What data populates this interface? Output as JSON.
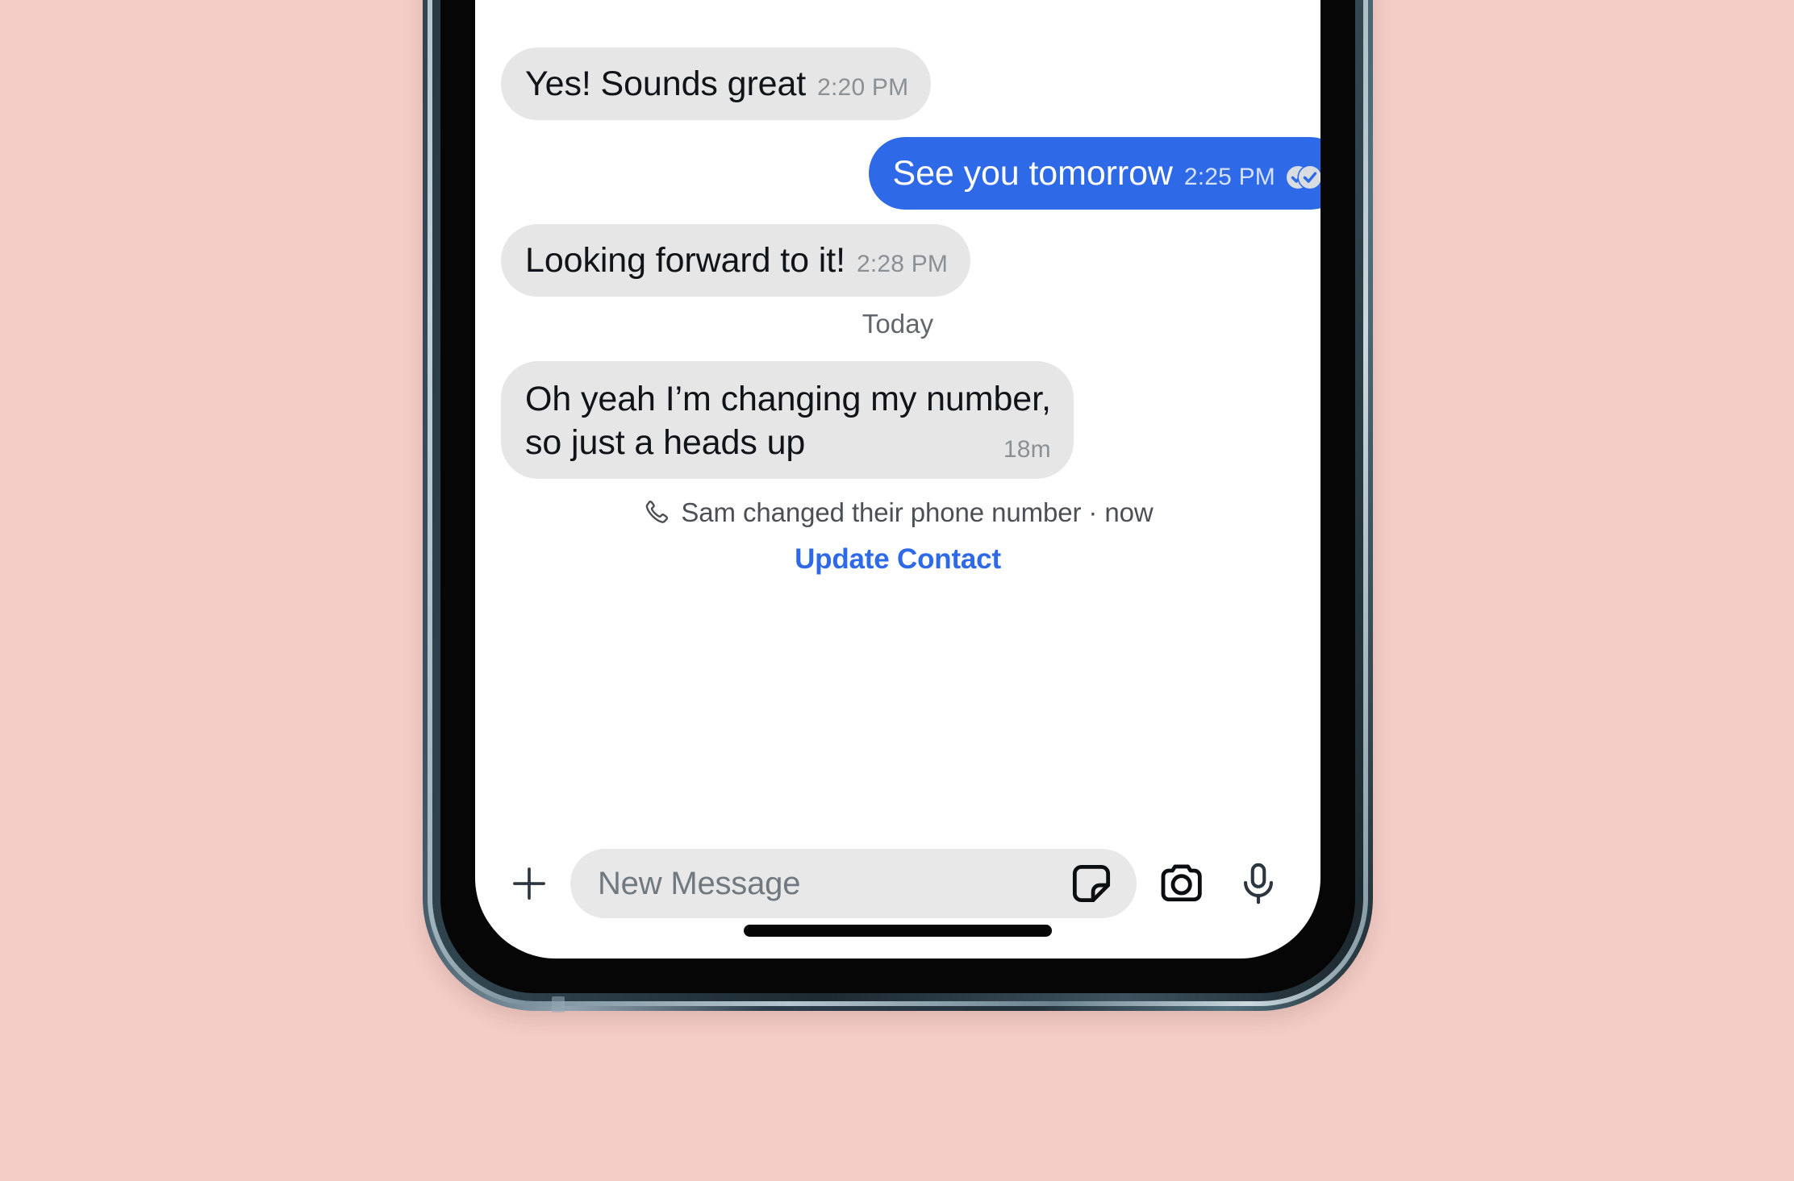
{
  "canvas": {
    "background_color": "#f4cdc6"
  },
  "device": {
    "frame_color": "#2d3f4c",
    "bezel_color": "#060606",
    "screen_color": "#ffffff",
    "home_indicator_color": "#050505"
  },
  "theme": {
    "incoming_bubble_color": "#e6e6e6",
    "outgoing_bubble_color": "#2e69e8",
    "incoming_text_color": "#101418",
    "outgoing_text_color": "#ffffff",
    "incoming_stamp_color": "#8b9095",
    "outgoing_stamp_color": "#d6e1fb",
    "link_color": "#2e69e8",
    "system_text_color": "#4c5055",
    "divider_text_color": "#62676c",
    "input_pill_color": "#e8e8e8",
    "placeholder_color": "#707880"
  },
  "conversation": {
    "messages": [
      {
        "id": "msg-1",
        "direction": "incoming",
        "text": "Yes! Sounds great",
        "timestamp": "2:20 PM",
        "multiline": false
      },
      {
        "id": "msg-2",
        "direction": "outgoing",
        "text": "See you tomorrow",
        "timestamp": "2:25 PM",
        "multiline": false,
        "receipt_icon": "double-check-read-icon"
      },
      {
        "id": "msg-3",
        "direction": "incoming",
        "text": "Looking forward to it!",
        "timestamp": "2:28 PM",
        "multiline": false
      }
    ],
    "date_divider": "Today",
    "last_message": {
      "id": "msg-4",
      "direction": "incoming",
      "line1": "Oh yeah I’m changing my number,",
      "line2": "so just a heads up",
      "timestamp": "18m"
    },
    "system_notice": {
      "icon": "phone-handset-icon",
      "text": "Sam changed their phone number · now",
      "action_label": "Update Contact"
    }
  },
  "composer": {
    "attach_icon": "plus-icon",
    "input_placeholder": "New Message",
    "input_value": "",
    "sticker_icon": "sticker-icon",
    "camera_icon": "camera-icon",
    "mic_icon": "microphone-icon"
  }
}
